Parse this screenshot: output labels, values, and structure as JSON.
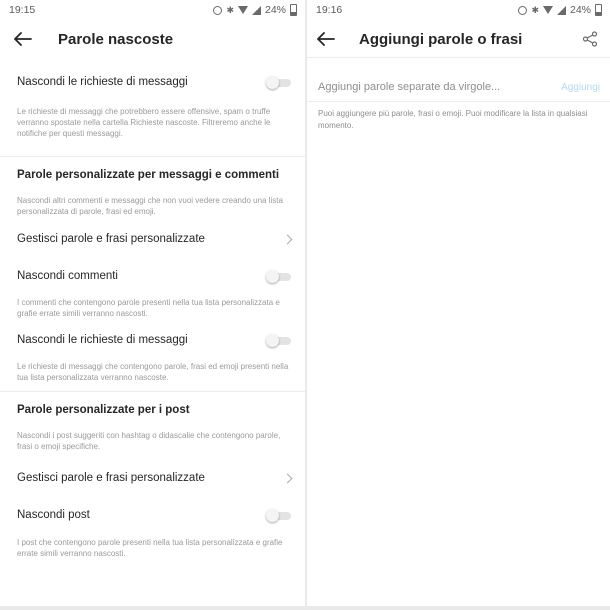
{
  "left": {
    "status": {
      "time": "19:15",
      "battery": "24%"
    },
    "title": "Parole nascoste",
    "hide_requests": {
      "label": "Nascondi le richieste di messaggi",
      "desc": "Le richieste di messaggi che potrebbero essere offensive, spam o truffe verranno spostate nella cartella Richieste nascoste. Filtreremo anche le notifiche per questi messaggi."
    },
    "custom_section": {
      "title": "Parole personalizzate per messaggi e commenti",
      "desc": "Nascondi altri commenti e messaggi che non vuoi vedere creando una lista personalizzata di parole, frasi ed emoji."
    },
    "manage_1": {
      "label": "Gestisci parole e frasi personalizzate"
    },
    "hide_comments": {
      "label": "Nascondi commenti",
      "desc": "I commenti che contengono parole presenti nella tua lista personalizzata e grafie errate simili verranno nascosti."
    },
    "hide_requests_2": {
      "label": "Nascondi le richieste di messaggi",
      "desc": "Le richieste di messaggi che contengono parole, frasi ed emoji presenti nella tua lista personalizzata verranno nascoste."
    },
    "posts_section": {
      "title": "Parole personalizzate per i post",
      "desc": "Nascondi i post suggeriti con hashtag o didascalie che contengono parole, frasi o emoji specifiche."
    },
    "manage_2": {
      "label": "Gestisci parole e frasi personalizzate"
    },
    "hide_posts": {
      "label": "Nascondi post",
      "desc": "I post che contengono parole presenti nella tua lista personalizzata e grafie errate simili verranno nascosti."
    }
  },
  "right": {
    "status": {
      "time": "19:16",
      "battery": "24%"
    },
    "title": "Aggiungi parole o frasi",
    "input_placeholder": "Aggiungi parole separate da virgole...",
    "add_label": "Aggiungi",
    "hint": "Puoi aggiungere più parole, frasi o emoji. Puoi modificare la lista in qualsiasi momento."
  },
  "colors": {
    "accent_disabled": "#b4d9f2",
    "toggle_off": "#e3e3e3",
    "secondary_text": "#9a9a9a"
  }
}
